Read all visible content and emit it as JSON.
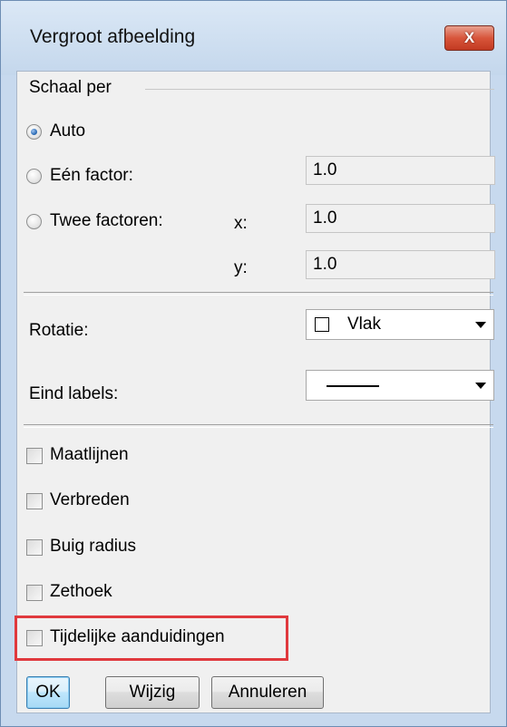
{
  "window": {
    "title": "Vergroot afbeelding",
    "close_label": "X"
  },
  "scale_group": {
    "title": "Schaal per",
    "options": [
      {
        "label": "Auto",
        "checked": true
      },
      {
        "label": "Eén factor:",
        "checked": false,
        "value": "1.0"
      },
      {
        "label": "Twee factoren:",
        "checked": false,
        "x_label": "x:",
        "x_value": "1.0",
        "y_label": "y:",
        "y_value": "1.0"
      }
    ]
  },
  "rotation": {
    "label": "Rotatie:",
    "value": "Vlak"
  },
  "end_labels": {
    "label": "Eind labels:",
    "value": "line-style"
  },
  "checkboxes": [
    {
      "label": "Maatlijnen",
      "checked": false
    },
    {
      "label": "Verbreden",
      "checked": false
    },
    {
      "label": "Buig radius",
      "checked": false
    },
    {
      "label": "Zethoek",
      "checked": false
    },
    {
      "label": "Tijdelijke aanduidingen",
      "checked": false
    }
  ],
  "buttons": {
    "ok": "OK",
    "change": "Wijzig",
    "cancel": "Annuleren"
  },
  "colors": {
    "highlight": "#e0393e",
    "title_bg": "#c7d9ee",
    "close_red": "#c23a22"
  }
}
